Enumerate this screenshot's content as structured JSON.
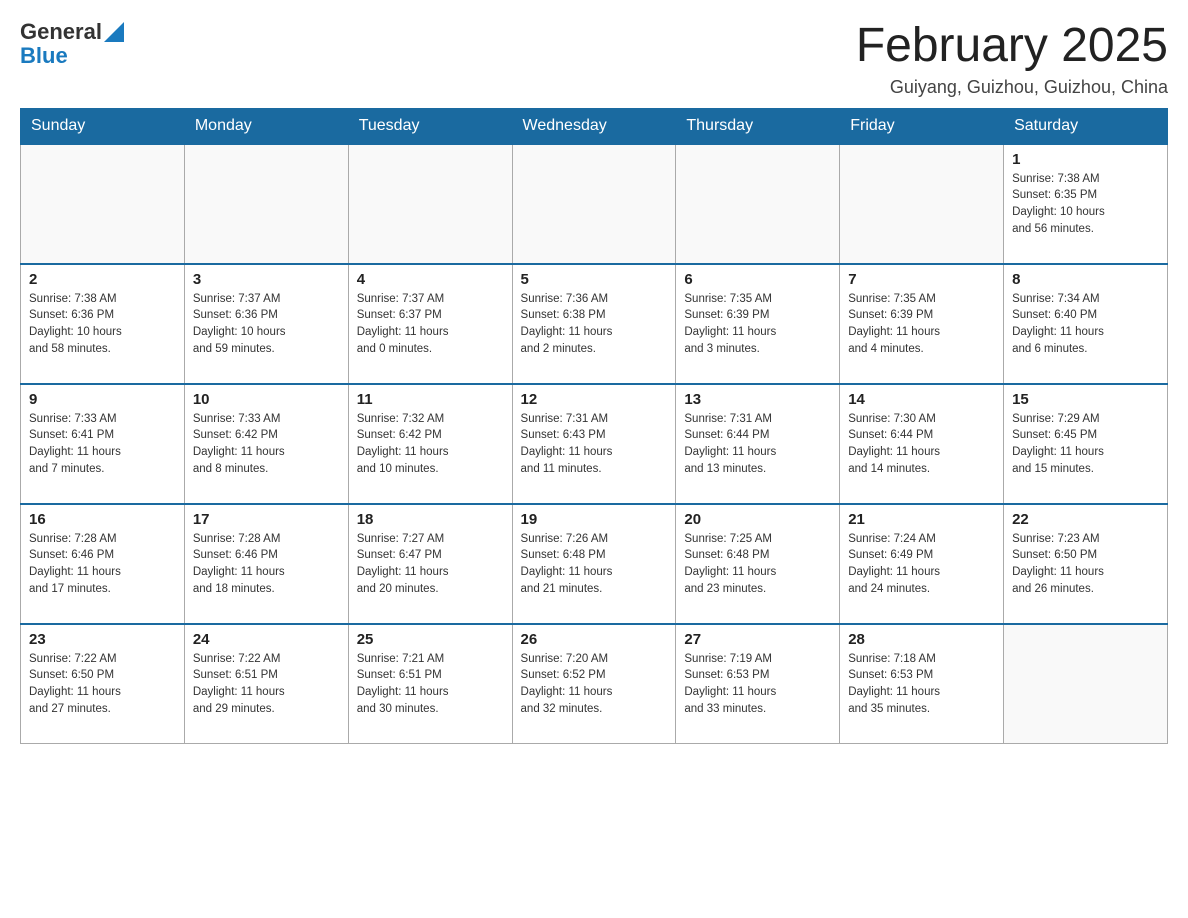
{
  "header": {
    "logo_general": "General",
    "logo_blue": "Blue",
    "month_title": "February 2025",
    "location": "Guiyang, Guizhou, Guizhou, China"
  },
  "days_of_week": [
    "Sunday",
    "Monday",
    "Tuesday",
    "Wednesday",
    "Thursday",
    "Friday",
    "Saturday"
  ],
  "weeks": [
    {
      "days": [
        {
          "number": "",
          "info": ""
        },
        {
          "number": "",
          "info": ""
        },
        {
          "number": "",
          "info": ""
        },
        {
          "number": "",
          "info": ""
        },
        {
          "number": "",
          "info": ""
        },
        {
          "number": "",
          "info": ""
        },
        {
          "number": "1",
          "info": "Sunrise: 7:38 AM\nSunset: 6:35 PM\nDaylight: 10 hours\nand 56 minutes."
        }
      ]
    },
    {
      "days": [
        {
          "number": "2",
          "info": "Sunrise: 7:38 AM\nSunset: 6:36 PM\nDaylight: 10 hours\nand 58 minutes."
        },
        {
          "number": "3",
          "info": "Sunrise: 7:37 AM\nSunset: 6:36 PM\nDaylight: 10 hours\nand 59 minutes."
        },
        {
          "number": "4",
          "info": "Sunrise: 7:37 AM\nSunset: 6:37 PM\nDaylight: 11 hours\nand 0 minutes."
        },
        {
          "number": "5",
          "info": "Sunrise: 7:36 AM\nSunset: 6:38 PM\nDaylight: 11 hours\nand 2 minutes."
        },
        {
          "number": "6",
          "info": "Sunrise: 7:35 AM\nSunset: 6:39 PM\nDaylight: 11 hours\nand 3 minutes."
        },
        {
          "number": "7",
          "info": "Sunrise: 7:35 AM\nSunset: 6:39 PM\nDaylight: 11 hours\nand 4 minutes."
        },
        {
          "number": "8",
          "info": "Sunrise: 7:34 AM\nSunset: 6:40 PM\nDaylight: 11 hours\nand 6 minutes."
        }
      ]
    },
    {
      "days": [
        {
          "number": "9",
          "info": "Sunrise: 7:33 AM\nSunset: 6:41 PM\nDaylight: 11 hours\nand 7 minutes."
        },
        {
          "number": "10",
          "info": "Sunrise: 7:33 AM\nSunset: 6:42 PM\nDaylight: 11 hours\nand 8 minutes."
        },
        {
          "number": "11",
          "info": "Sunrise: 7:32 AM\nSunset: 6:42 PM\nDaylight: 11 hours\nand 10 minutes."
        },
        {
          "number": "12",
          "info": "Sunrise: 7:31 AM\nSunset: 6:43 PM\nDaylight: 11 hours\nand 11 minutes."
        },
        {
          "number": "13",
          "info": "Sunrise: 7:31 AM\nSunset: 6:44 PM\nDaylight: 11 hours\nand 13 minutes."
        },
        {
          "number": "14",
          "info": "Sunrise: 7:30 AM\nSunset: 6:44 PM\nDaylight: 11 hours\nand 14 minutes."
        },
        {
          "number": "15",
          "info": "Sunrise: 7:29 AM\nSunset: 6:45 PM\nDaylight: 11 hours\nand 15 minutes."
        }
      ]
    },
    {
      "days": [
        {
          "number": "16",
          "info": "Sunrise: 7:28 AM\nSunset: 6:46 PM\nDaylight: 11 hours\nand 17 minutes."
        },
        {
          "number": "17",
          "info": "Sunrise: 7:28 AM\nSunset: 6:46 PM\nDaylight: 11 hours\nand 18 minutes."
        },
        {
          "number": "18",
          "info": "Sunrise: 7:27 AM\nSunset: 6:47 PM\nDaylight: 11 hours\nand 20 minutes."
        },
        {
          "number": "19",
          "info": "Sunrise: 7:26 AM\nSunset: 6:48 PM\nDaylight: 11 hours\nand 21 minutes."
        },
        {
          "number": "20",
          "info": "Sunrise: 7:25 AM\nSunset: 6:48 PM\nDaylight: 11 hours\nand 23 minutes."
        },
        {
          "number": "21",
          "info": "Sunrise: 7:24 AM\nSunset: 6:49 PM\nDaylight: 11 hours\nand 24 minutes."
        },
        {
          "number": "22",
          "info": "Sunrise: 7:23 AM\nSunset: 6:50 PM\nDaylight: 11 hours\nand 26 minutes."
        }
      ]
    },
    {
      "days": [
        {
          "number": "23",
          "info": "Sunrise: 7:22 AM\nSunset: 6:50 PM\nDaylight: 11 hours\nand 27 minutes."
        },
        {
          "number": "24",
          "info": "Sunrise: 7:22 AM\nSunset: 6:51 PM\nDaylight: 11 hours\nand 29 minutes."
        },
        {
          "number": "25",
          "info": "Sunrise: 7:21 AM\nSunset: 6:51 PM\nDaylight: 11 hours\nand 30 minutes."
        },
        {
          "number": "26",
          "info": "Sunrise: 7:20 AM\nSunset: 6:52 PM\nDaylight: 11 hours\nand 32 minutes."
        },
        {
          "number": "27",
          "info": "Sunrise: 7:19 AM\nSunset: 6:53 PM\nDaylight: 11 hours\nand 33 minutes."
        },
        {
          "number": "28",
          "info": "Sunrise: 7:18 AM\nSunset: 6:53 PM\nDaylight: 11 hours\nand 35 minutes."
        },
        {
          "number": "",
          "info": ""
        }
      ]
    }
  ]
}
